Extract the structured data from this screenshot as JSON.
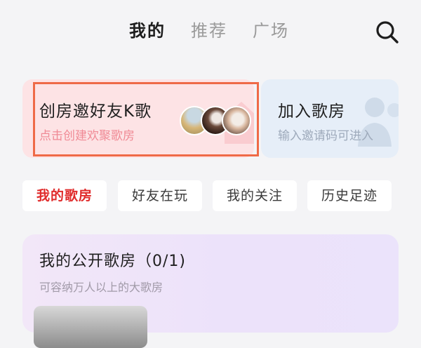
{
  "nav": {
    "tabs": [
      {
        "label": "我的",
        "active": true
      },
      {
        "label": "推荐",
        "active": false
      },
      {
        "label": "广场",
        "active": false
      }
    ],
    "search_icon": "search-icon"
  },
  "cards": {
    "create": {
      "title": "创房邀好友K歌",
      "subtitle": "点击创建欢聚歌房"
    },
    "join": {
      "title": "加入歌房",
      "subtitle": "输入邀请码可进入"
    }
  },
  "filters": [
    {
      "label": "我的歌房",
      "active": true
    },
    {
      "label": "好友在玩",
      "active": false
    },
    {
      "label": "我的关注",
      "active": false
    },
    {
      "label": "历史足迹",
      "active": false
    }
  ],
  "public_rooms": {
    "title": "我的公开歌房（0/1)",
    "subtitle": "可容纳万人以上的大歌房"
  },
  "colors": {
    "accent": "#e02b2b",
    "create_card_bg": "#fde3e5",
    "join_card_bg": "#e6eef8",
    "highlight": "#ef6a47"
  }
}
